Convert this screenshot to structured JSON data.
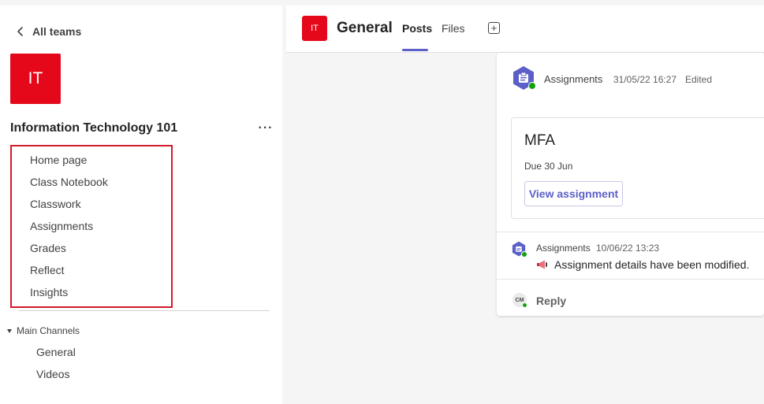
{
  "sidebar": {
    "back_label": "All teams",
    "team_avatar": "IT",
    "team_name": "Information Technology 101",
    "more_label": "···",
    "tabs": [
      {
        "label": "Home page"
      },
      {
        "label": "Class Notebook"
      },
      {
        "label": "Classwork"
      },
      {
        "label": "Assignments"
      },
      {
        "label": "Grades"
      },
      {
        "label": "Reflect"
      },
      {
        "label": "Insights"
      }
    ],
    "channels_header": "Main Channels",
    "channels": [
      {
        "label": "General"
      },
      {
        "label": "Videos"
      }
    ]
  },
  "header": {
    "avatar": "IT",
    "title": "General",
    "tabs": [
      {
        "label": "Posts",
        "active": true
      },
      {
        "label": "Files",
        "active": false
      }
    ],
    "add_tab_label": "+"
  },
  "post": {
    "author": "Assignments",
    "timestamp": "31/05/22 16:27",
    "edited": "Edited",
    "card": {
      "title": "MFA",
      "due": "Due 30 Jun",
      "button": "View assignment"
    },
    "reply_item": {
      "author": "Assignments",
      "timestamp": "10/06/22 13:23",
      "message": "Assignment details have been modified."
    },
    "reply_avatar": "CM",
    "reply_label": "Reply"
  },
  "colors": {
    "team_red": "#e5081a",
    "accent": "#5b5fc7",
    "highlight_box": "#d11a2a",
    "presence_green": "#13a10e"
  }
}
